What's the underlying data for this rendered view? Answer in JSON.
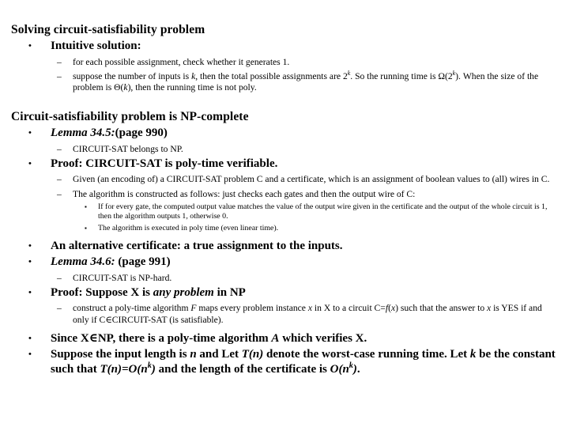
{
  "slide": {
    "background_color": "#ffffff",
    "text_color": "#000000",
    "section1": {
      "heading": "Solving circuit-satisfiability problem",
      "bullet1": "Intuitive solution:",
      "sub1": "for each possible assignment, check whether it generates 1.",
      "sub2_part1": "suppose the number of inputs is ",
      "sub2_k1": "k",
      "sub2_part2": ", then the total possible assignments are 2",
      "sub2_sup1": "k",
      "sub2_part3": ".  So the running time is Ω(2",
      "sub2_sup2": "k",
      "sub2_part4": "). When the size of the problem is Θ(",
      "sub2_k2": "k",
      "sub2_part5": "), then the running time is not poly."
    },
    "section2": {
      "heading": "Circuit-satisfiability problem is NP-complete",
      "lemma345_italic": "Lemma 34.5:",
      "lemma345_page": "(page 990)",
      "lemma345_sub": "CIRCUIT-SAT belongs to NP.",
      "proof1": "Proof: CIRCUIT-SAT is poly-time verifiable.",
      "proof1_sub1": "Given (an encoding of) a CIRCUIT-SAT problem C and a certificate, which is an assignment of boolean values to (all) wires in C.",
      "proof1_sub2": "The algorithm is constructed as follows:  just checks each gates and then the output wire of C:",
      "proof1_sub2_a": "If for every gate, the computed output value matches the value of the output wire given in the certificate and  the output of the whole circuit is 1, then the algorithm outputs 1, otherwise 0.",
      "proof1_sub2_b": "The algorithm is executed in poly time (even linear time).",
      "alt_certificate": "An alternative certificate: a true assignment to the inputs.",
      "lemma346_italic": "Lemma 34.6:",
      "lemma346_page": " (page 991)",
      "lemma346_sub": "CIRCUIT-SAT is NP-hard.",
      "proof2_part1": "Proof: Suppose X is ",
      "proof2_italic": "any problem",
      "proof2_part2": " in NP",
      "proof2_sub_part1": "construct a poly-time algorithm ",
      "proof2_sub_F": "F",
      "proof2_sub_part2": " maps every problem instance ",
      "proof2_sub_x1": "x",
      "proof2_sub_part3": " in X to a circuit C=",
      "proof2_sub_f": "f",
      "proof2_sub_part4": "(",
      "proof2_sub_x2": "x",
      "proof2_sub_part5": ") such that the answer to ",
      "proof2_sub_x3": "x",
      "proof2_sub_part6": " is YES if and only if C∈CIRCUIT-SAT (is satisfiable).",
      "since_part1": "Since  X∈NP, there is a poly-time algorithm ",
      "since_A": "A",
      "since_part2": " which verifies X.",
      "suppose_part1": "Suppose the input length is ",
      "suppose_n1": "n",
      "suppose_part2": " and Let ",
      "suppose_T1": "T(n)",
      "suppose_part3": " denote the worst-case running time. Let ",
      "suppose_k1": "k",
      "suppose_part4": " be the constant such that ",
      "suppose_T2": "T(n)=O(n",
      "suppose_sup1": "k",
      "suppose_T3": ")",
      "suppose_part5": " and the length of the certificate is ",
      "suppose_O": "O(n",
      "suppose_sup2": "k",
      "suppose_O2": ")",
      "suppose_part6": "."
    },
    "icons": {
      "bullet_dot": "•",
      "bullet_dash": "–",
      "bullet_square": "▪"
    }
  }
}
